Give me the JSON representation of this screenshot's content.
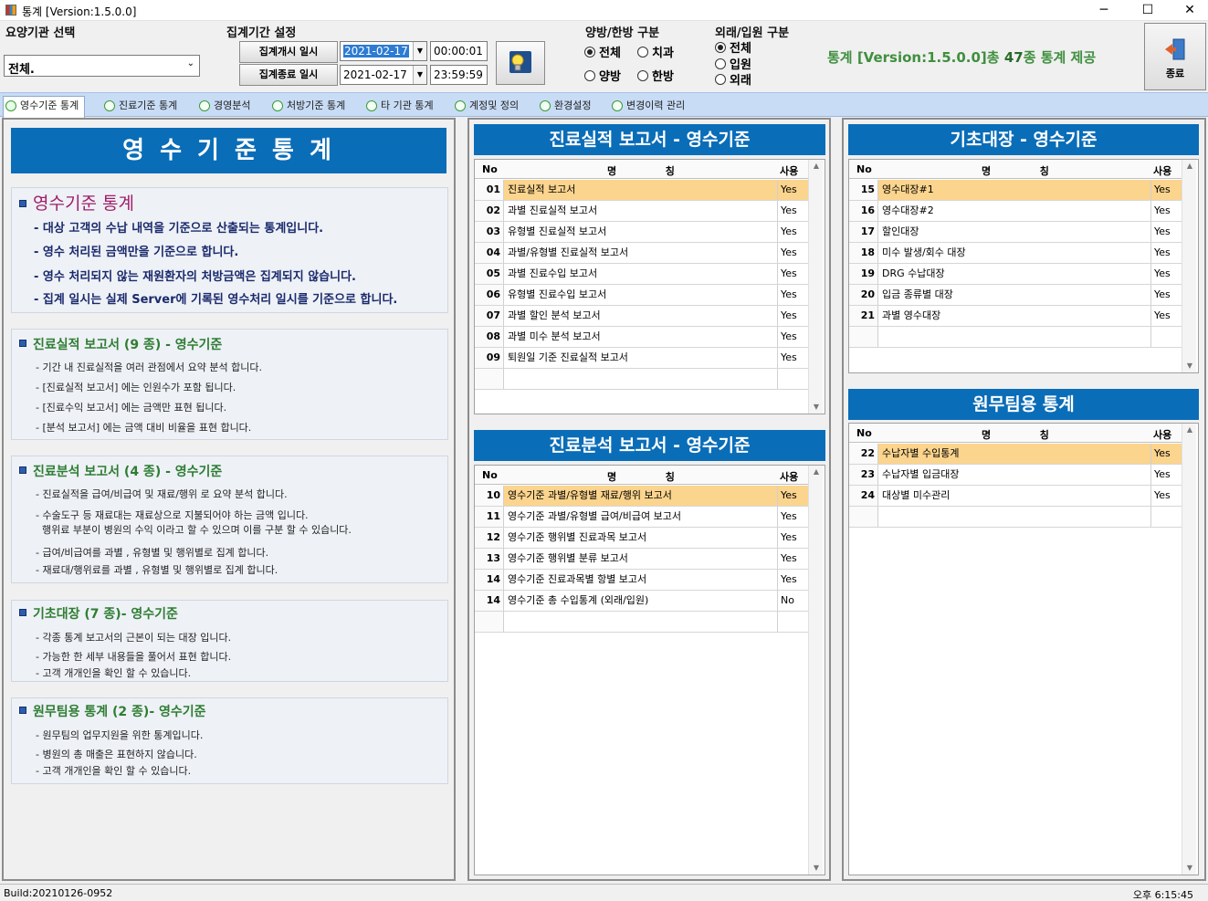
{
  "window": {
    "title": "통계 [Version:1.5.0.0]",
    "minimize": "─",
    "maximize": "☐",
    "close": "✕"
  },
  "toolbar": {
    "hospital_label": "요양기관 선택",
    "hospital_value": "전체.",
    "period_label": "집계기간 설정",
    "start_button": "집계개시 일시",
    "end_button": "집계종료 일시",
    "start_date": "2021-02-17",
    "start_time": "00:00:01",
    "end_date": "2021-02-17",
    "end_time": "23:59:59",
    "type_label": "양방/한방 구분",
    "type_options": {
      "all": "전체",
      "dental": "치과",
      "western": "양방",
      "oriental": "한방"
    },
    "visit_label": "외래/입원 구분",
    "visit_options": {
      "all": "전체",
      "inpatient": "입원",
      "outpatient": "외래"
    },
    "info_prefix": "통계 [Version:1.5.0.0]",
    "info_mid": "총 ",
    "info_count": "47",
    "info_suffix": "종 통계 제공",
    "exit_label": "종료"
  },
  "tabs": [
    {
      "label": "영수기준 통계"
    },
    {
      "label": "진료기준 통계"
    },
    {
      "label": "경영분석"
    },
    {
      "label": "처방기준 통계"
    },
    {
      "label": "타 기관 통계"
    },
    {
      "label": "계정및 정의"
    },
    {
      "label": "환경설정"
    },
    {
      "label": "변경이력 관리"
    }
  ],
  "left": {
    "title": "영 수 기 준 통 계",
    "intro": {
      "heading": "영수기준  통계",
      "lines": [
        "- 대상 고객의 수납 내역을 기준으로 산출되는 통계입니다.",
        "- 영수 처리된 금액만을 기준으로 합니다.",
        "- 영수 처리되지 않는 재원환자의 처방금액은 집계되지 않습니다.",
        "- 집계 일시는 실제 Server에 기록된 영수처리 일시를 기준으로 합니다."
      ]
    },
    "sec1": {
      "heading_a": "진료실적 보고서 ",
      "heading_b": "(9 종)",
      "heading_c": " - 영수기준",
      "lines": [
        "- 기간 내 진료실적을 여러 관점에서 요약  분석 합니다.",
        "- [진료실적 보고서] 에는 인원수가 포함 됩니다.",
        "- [진료수익 보고서] 에는 금액만 표현 됩니다.",
        "- [분석 보고서] 에는 금액 대비 비율을 표현 합니다."
      ]
    },
    "sec2": {
      "heading_a": "진료분석 보고서 ",
      "heading_b": "(4 종)",
      "heading_c": " - 영수기준",
      "lines": [
        "- 진료실적을 급여/비급여 및 재료/행위 로 요약  분석 합니다.",
        "- 수술도구 등 재료대는 재료상으로 지불되어야 하는  금액 입니다.",
        "  행위료 부분이 병원의 수익 이라고 할 수 있으며 이를 구분 할 수 있습니다.",
        "- 급여/비급여를 과별 , 유형별 및 행위별로 집계 합니다.",
        "- 재료대/행위료를 과별 , 유형별 및 행위별로 집계 합니다."
      ]
    },
    "sec3": {
      "heading_a": "기초대장  ",
      "heading_b": "(7 종)",
      "heading_c": "- 영수기준",
      "lines": [
        "- 각종 통계 보고서의 근본이 되는 대장 입니다.",
        "- 가능한 한 세부 내용들을 풀어서 표현 합니다.",
        "- 고객 개개인을 확인 할 수 있습니다."
      ]
    },
    "sec4": {
      "heading_a": "원무팀용 통계 ",
      "heading_b": "(2 종)",
      "heading_c": "- 영수기준",
      "lines": [
        "- 원무팀의 업무지원을 위한 통계입니다.",
        "- 병원의 총 매출은 표현하지 않습니다.",
        "- 고객 개개인을 확인 할 수 있습니다."
      ]
    }
  },
  "grid_header": {
    "no": "No",
    "name": "명              칭",
    "use": "사용"
  },
  "report1": {
    "title": "진료실적 보고서 - 영수기준",
    "rows": [
      {
        "no": "01",
        "name": "진료실적 보고서",
        "use": "Yes"
      },
      {
        "no": "02",
        "name": "과별 진료실적 보고서",
        "use": "Yes"
      },
      {
        "no": "03",
        "name": "유형별 진료실적 보고서",
        "use": "Yes"
      },
      {
        "no": "04",
        "name": "과별/유형별 진료실적 보고서",
        "use": "Yes"
      },
      {
        "no": "05",
        "name": "과별 진료수입 보고서",
        "use": "Yes"
      },
      {
        "no": "06",
        "name": "유형별 진료수입 보고서",
        "use": "Yes"
      },
      {
        "no": "07",
        "name": "과별 할인 분석 보고서",
        "use": "Yes"
      },
      {
        "no": "08",
        "name": "과별 미수 분석 보고서",
        "use": "Yes"
      },
      {
        "no": "09",
        "name": "퇴원일 기준 진료실적 보고서",
        "use": "Yes"
      }
    ]
  },
  "report2": {
    "title": "진료분석 보고서 - 영수기준",
    "rows": [
      {
        "no": "10",
        "name": "영수기준 과별/유형별 재료/행위 보고서",
        "use": "Yes"
      },
      {
        "no": "11",
        "name": "영수기준 과별/유형별 급여/비급여 보고서",
        "use": "Yes"
      },
      {
        "no": "12",
        "name": "영수기준 행위별 진료과목 보고서",
        "use": "Yes"
      },
      {
        "no": "13",
        "name": "영수기준 행위별 분류 보고서",
        "use": "Yes"
      },
      {
        "no": "14",
        "name": "영수기준 진료과목별 항별 보고서",
        "use": "Yes"
      },
      {
        "no": "14",
        "name": "영수기준 총 수입통계 (외래/입원)",
        "use": "No"
      }
    ]
  },
  "report3": {
    "title": "기초대장 - 영수기준",
    "rows": [
      {
        "no": "15",
        "name": "영수대장#1",
        "use": "Yes"
      },
      {
        "no": "16",
        "name": "영수대장#2",
        "use": "Yes"
      },
      {
        "no": "17",
        "name": "할인대장",
        "use": "Yes"
      },
      {
        "no": "18",
        "name": "미수 발생/회수 대장",
        "use": "Yes"
      },
      {
        "no": "19",
        "name": "DRG 수납대장",
        "use": "Yes"
      },
      {
        "no": "20",
        "name": "입금 종류별 대장",
        "use": "Yes"
      },
      {
        "no": "21",
        "name": "과별 영수대장",
        "use": "Yes"
      }
    ]
  },
  "report4": {
    "title": "원무팀용 통계",
    "rows": [
      {
        "no": "22",
        "name": "수납자별 수입통계",
        "use": "Yes"
      },
      {
        "no": "23",
        "name": "수납자별 입금대장",
        "use": "Yes"
      },
      {
        "no": "24",
        "name": "대상별 미수관리",
        "use": "Yes"
      }
    ]
  },
  "status": {
    "build": "Build:20210126-0952",
    "time": "오후 6:15:45"
  },
  "colors": {
    "accent_blue": "#0a6db8",
    "selected_row": "#fbd48e",
    "tab_bar": "#c8dcf5",
    "heading_green": "#2e7d32",
    "intro_pink": "#a0206a"
  }
}
